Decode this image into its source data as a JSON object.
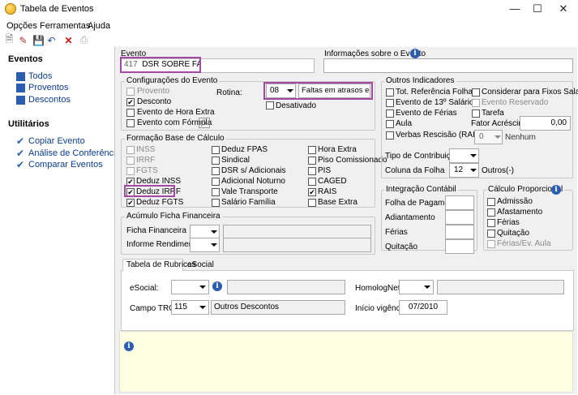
{
  "window": {
    "title": "Tabela de Eventos"
  },
  "menu": [
    "Opções",
    "Ferramentas",
    "Ajuda"
  ],
  "sidebar": {
    "eventos_title": "Eventos",
    "eventos": [
      "Todos",
      "Proventos",
      "Descontos"
    ],
    "utilitarios_title": "Utilitários",
    "utilitarios": [
      "Copiar Evento",
      "Análise de Conferência",
      "Comparar Eventos"
    ]
  },
  "evento": {
    "label": "Evento",
    "code": "417",
    "name": "DSR SOBRE FALTAS"
  },
  "info": {
    "label": "Informações sobre o Evento"
  },
  "config": {
    "title": "Configurações do Evento",
    "provento": "Provento",
    "desconto": "Desconto",
    "hora_extra": "Evento de Hora Extra",
    "formula": "Evento com Fórmula",
    "rotina_label": "Rotina:",
    "rotina_code": "08",
    "rotina_name": "Faltas em atrasos em dia",
    "desativado": "Desativado",
    "fx": "fx"
  },
  "formacao": {
    "title": "Formação Base de Cálculo",
    "col1": [
      {
        "t": "INSS",
        "c": false,
        "d": true
      },
      {
        "t": "IRRF",
        "c": false,
        "d": true
      },
      {
        "t": "FGTS",
        "c": false,
        "d": true
      },
      {
        "t": "Deduz INSS",
        "c": true,
        "d": false
      },
      {
        "t": "Deduz IRRF",
        "c": true,
        "d": false
      },
      {
        "t": "Deduz FGTS",
        "c": true,
        "d": false
      }
    ],
    "col2": [
      {
        "t": "Deduz FPAS",
        "c": false
      },
      {
        "t": "Sindical",
        "c": false
      },
      {
        "t": "DSR s/ Adicionais",
        "c": false
      },
      {
        "t": "Adicional Noturno",
        "c": false
      },
      {
        "t": "Vale Transporte",
        "c": false
      },
      {
        "t": "Salário Família",
        "c": false
      }
    ],
    "col3": [
      {
        "t": "Hora Extra",
        "c": false
      },
      {
        "t": "Piso Comissionado",
        "c": false
      },
      {
        "t": "PIS",
        "c": false
      },
      {
        "t": "CAGED",
        "c": false
      },
      {
        "t": "RAIS",
        "c": true
      },
      {
        "t": "Base Extra",
        "c": false
      }
    ]
  },
  "acumulo": {
    "title": "Acúmulo Ficha Financeira",
    "ficha": "Ficha Financeira",
    "informe": "Informe Rendimentos"
  },
  "outros": {
    "title": "Outros Indicadores",
    "tot_ref": "Tot. Referência Folha",
    "decimo": "Evento de 13º Salário",
    "ferias": "Evento de Férias",
    "aula": "Aula",
    "verbas": "Verbas Rescisão (RAIS)",
    "considerar": "Considerar para Fixos Salariais",
    "reservado": "Evento Reservado",
    "tarefa": "Tarefa",
    "fator_label": "Fator Acréscimo",
    "fator_value": "0,00",
    "verbas_value": "0",
    "nenhum": "Nenhum",
    "tipo_contrib": "Tipo de Contribuição",
    "coluna_folha": "Coluna da Folha",
    "coluna_value": "12",
    "coluna_name": "Outros(-)"
  },
  "integracao": {
    "title": "Integração Contábil",
    "items": [
      "Folha de Pagamento",
      "Adiantamento",
      "Férias",
      "Quitação"
    ]
  },
  "calculo": {
    "title": "Cálculo Proporcional",
    "items": [
      {
        "t": "Admissão",
        "d": false
      },
      {
        "t": "Afastamento",
        "d": false
      },
      {
        "t": "Férias",
        "d": false
      },
      {
        "t": "Quitação",
        "d": false
      },
      {
        "t": "Férias/Ev. Aula",
        "d": true
      }
    ]
  },
  "tabs": [
    "Tabela de Rubricas",
    "eSocial"
  ],
  "rubricas": {
    "esocial": "eSocial:",
    "homolognet": "HomologNet:",
    "campo_trct": "Campo TRCT:",
    "trct_code": "115",
    "trct_name": "Outros Descontos",
    "inicio": "Início vigência:",
    "inicio_value": "07/2010"
  }
}
